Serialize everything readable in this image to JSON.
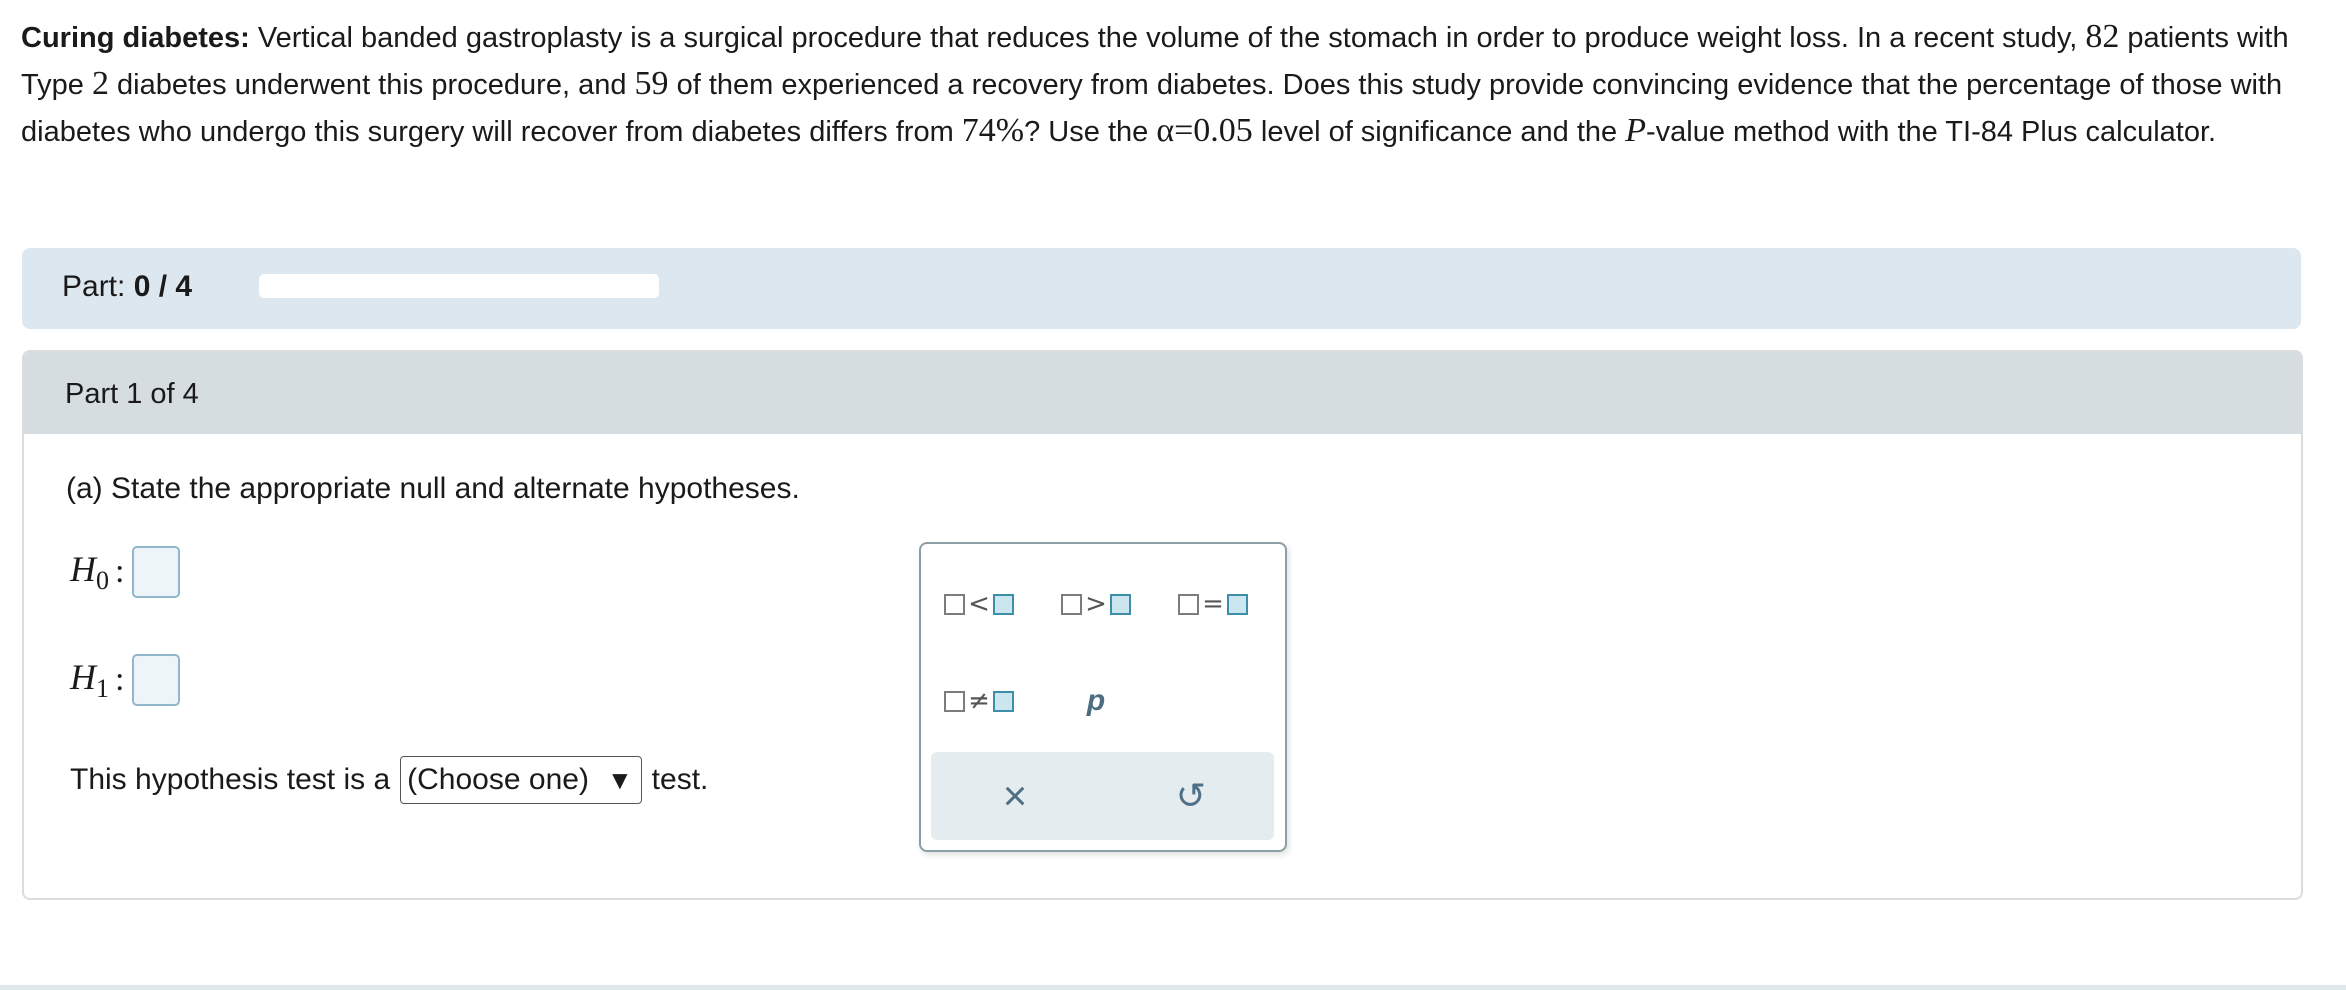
{
  "problem": {
    "title": "Curing diabetes:",
    "t1": " Vertical banded gastroplasty is a surgical procedure that reduces the volume of the stomach in order to produce weight loss. In a recent study, ",
    "n": "82",
    "t2": " patients with Type ",
    "type": "2",
    "t3": " diabetes underwent this procedure, and ",
    "x": "59",
    "t4": " of them experienced a recovery from diabetes. Does this study provide convincing evidence that the percentage of those with diabetes who undergo this surgery will recover from diabetes differs from ",
    "pct": "74%",
    "t5": "? Use the ",
    "alpha": "α=0.05",
    "t6": " level of significance and the ",
    "pvar": "P",
    "t7": "-value method with the TI-84 Plus calculator."
  },
  "progress": {
    "label": "Part: ",
    "value": "0 / 4",
    "completed": 0,
    "total": 4
  },
  "part": {
    "header": "Part 1 of 4",
    "question": "(a) State the appropriate null and alternate hypotheses.",
    "h0_label": "H",
    "h0_sub": "0",
    "h1_label": "H",
    "h1_sub": "1",
    "colon": ":",
    "test_prefix": "This hypothesis test is a",
    "select_value": "(Choose one)",
    "test_suffix": "test."
  },
  "palette": {
    "lt": "<",
    "gt": ">",
    "eq": "=",
    "neq": "≠",
    "p": "p",
    "clear_icon": "×",
    "undo_icon": "↺"
  },
  "colors": {
    "progress_bg": "#dde7ef",
    "part_header_bg": "#d5dde1",
    "answer_box_border": "#8fb7c9",
    "palette_icon": "#4e6f86"
  }
}
